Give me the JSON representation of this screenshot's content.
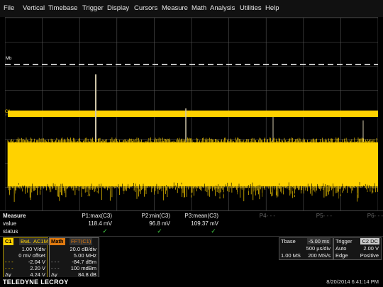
{
  "menu": [
    "File",
    "Vertical",
    "Timebase",
    "Trigger",
    "Display",
    "Cursors",
    "Measure",
    "Math",
    "Analysis",
    "Utilities",
    "Help"
  ],
  "screen": {
    "markers": {
      "mb": "Mb",
      "c1": "C1"
    },
    "colors": {
      "trace": "#ffd200",
      "grid": "#555555",
      "math": "#ffffff"
    }
  },
  "measure": {
    "label": "Measure",
    "row_value": "value",
    "row_status": "status",
    "params": [
      {
        "name": "P1:max(C3)",
        "value": "118.4 mV",
        "status": "✓"
      },
      {
        "name": "P2:min(C3)",
        "value": "96.8 mV",
        "status": "✓"
      },
      {
        "name": "P3:mean(C3)",
        "value": "109.37 mV",
        "status": "✓"
      },
      {
        "name": "P4- - -",
        "value": "",
        "status": ""
      },
      {
        "name": "P5- - -",
        "value": "",
        "status": ""
      },
      {
        "name": "P6- - -",
        "value": "",
        "status": ""
      }
    ]
  },
  "c1": {
    "tag": "C1",
    "coupling": "BwL",
    "mode": "AC1M",
    "vdiv": "1.00 V/div",
    "offset": "0 mV offset",
    "r1": "-2.04 V",
    "r2": "2.20 V",
    "dy_label": "Δy",
    "r3": "4.24 V"
  },
  "math": {
    "tag": "Math",
    "func": "FFT(C1)",
    "r0": "20.0 dB/div",
    "r1": "5.00 MHz",
    "r2": "-84.7 dBm",
    "r3": "100 mdBm",
    "dy_label": "Δy",
    "r4": "84.8 dB"
  },
  "tbase": {
    "label": "Tbase",
    "delay": "-5.00 ms",
    "r1": "500 µs/div",
    "r2a": "1.00 MS",
    "r2b": "200 MS/s"
  },
  "trigger": {
    "label": "Trigger",
    "tags": "C2 DC",
    "r1a": "Auto",
    "r1b": "2.00 V",
    "r2a": "Edge",
    "r2b": "Positive"
  },
  "footer": {
    "brand": "TELEDYNE LECROY",
    "timestamp": "8/20/2014 6:41:14 PM"
  }
}
